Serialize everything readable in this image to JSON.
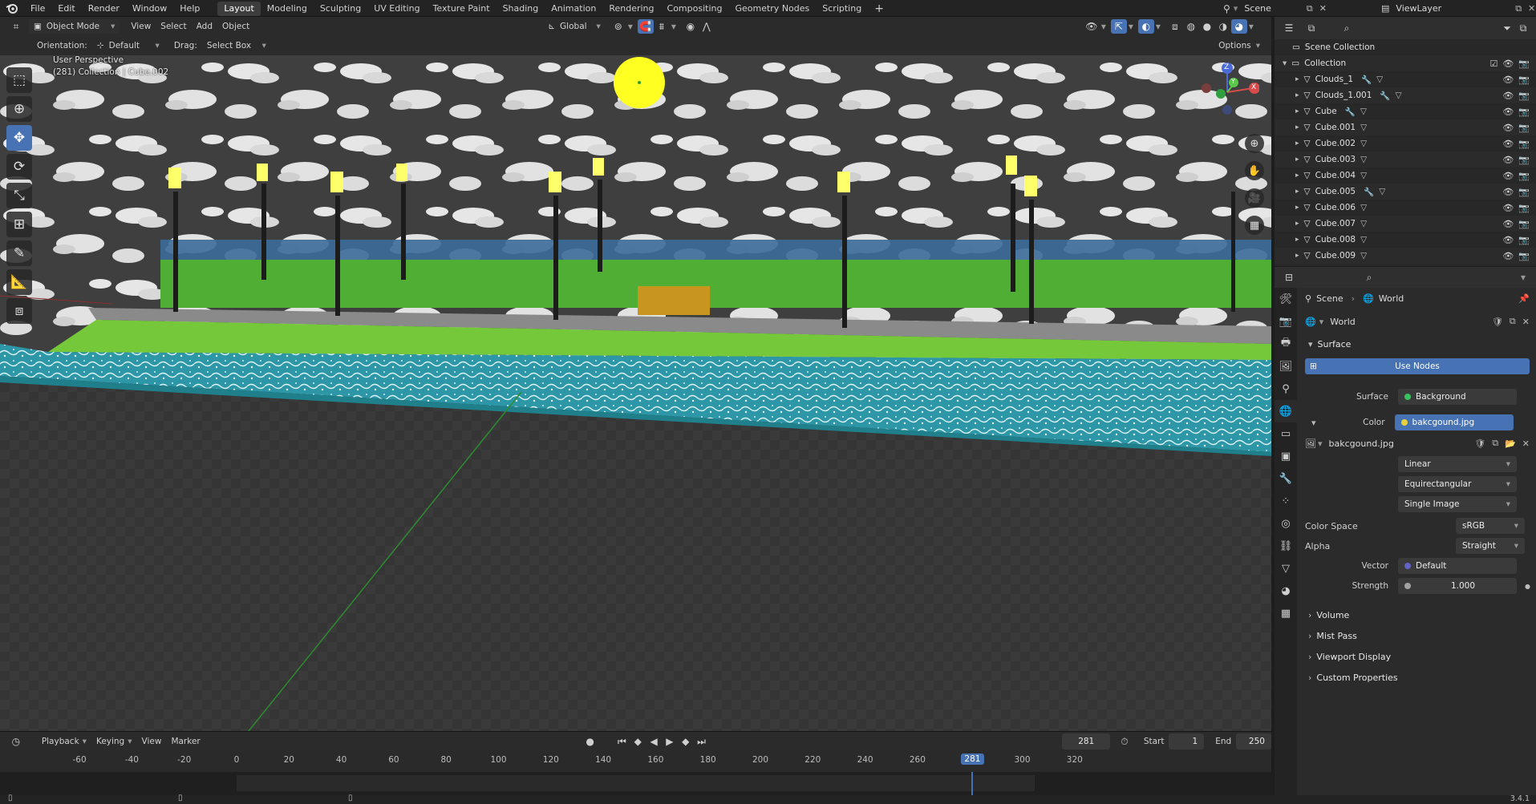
{
  "topbar": {
    "menus": [
      "File",
      "Edit",
      "Render",
      "Window",
      "Help"
    ],
    "workspaces": [
      "Layout",
      "Modeling",
      "Sculpting",
      "UV Editing",
      "Texture Paint",
      "Shading",
      "Animation",
      "Rendering",
      "Compositing",
      "Geometry Nodes",
      "Scripting"
    ],
    "active_workspace": "Layout",
    "add_label": "+",
    "scene_label": "Scene",
    "view_layer_label": "ViewLayer"
  },
  "viewport_header": {
    "mode": "Object Mode",
    "menus": [
      "View",
      "Select",
      "Add",
      "Object"
    ],
    "transform_orientation": "Global",
    "orientation_label": "Orientation:",
    "orientation_value": "Default",
    "drag_label": "Drag:",
    "drag_value": "Select Box",
    "options_label": "Options"
  },
  "viewport": {
    "overlay_line1": "User Perspective",
    "overlay_line2": "(281) Collection | Cube.002",
    "gizmo_axes": {
      "x": "X",
      "y": "Y",
      "z": "Z"
    },
    "colors": {
      "sky": "#c9c9c9",
      "sun": "#ffff22",
      "grass": "#58b33a",
      "water": "#2aa6b0",
      "floor": "#393939"
    }
  },
  "timeline": {
    "menus": [
      "Playback",
      "Keying",
      "View",
      "Marker"
    ],
    "current_frame": "281",
    "start_label": "Start",
    "start_value": "1",
    "end_label": "End",
    "end_value": "250",
    "ticks": [
      "-60",
      "-40",
      "-20",
      "0",
      "20",
      "40",
      "60",
      "80",
      "100",
      "120",
      "140",
      "160",
      "180",
      "200",
      "220",
      "240",
      "260",
      "281",
      "300",
      "320"
    ],
    "playhead_label": "281"
  },
  "statusbar": {
    "version": "3.4.1"
  },
  "outliner": {
    "root": "Scene Collection",
    "collection": "Collection",
    "items": [
      {
        "name": "Clouds_1",
        "modifier": true
      },
      {
        "name": "Clouds_1.001",
        "modifier": true
      },
      {
        "name": "Cube",
        "modifier": true
      },
      {
        "name": "Cube.001",
        "modifier": false
      },
      {
        "name": "Cube.002",
        "modifier": false
      },
      {
        "name": "Cube.003",
        "modifier": false
      },
      {
        "name": "Cube.004",
        "modifier": false
      },
      {
        "name": "Cube.005",
        "modifier": true
      },
      {
        "name": "Cube.006",
        "modifier": false
      },
      {
        "name": "Cube.007",
        "modifier": false
      },
      {
        "name": "Cube.008",
        "modifier": false
      },
      {
        "name": "Cube.009",
        "modifier": false
      }
    ]
  },
  "properties": {
    "breadcrumb_scene": "Scene",
    "breadcrumb_world": "World",
    "world_name": "World",
    "surface_panel": "Surface",
    "use_nodes": "Use Nodes",
    "surface_label": "Surface",
    "surface_value": "Background",
    "color_label": "Color",
    "color_value": "bakcgound.jpg",
    "image_name": "bakcgound.jpg",
    "interpolation": "Linear",
    "projection": "Equirectangular",
    "source": "Single Image",
    "color_space_label": "Color Space",
    "color_space_value": "sRGB",
    "alpha_label": "Alpha",
    "alpha_value": "Straight",
    "vector_label": "Vector",
    "vector_value": "Default",
    "strength_label": "Strength",
    "strength_value": "1.000",
    "collapsed_panels": [
      "Volume",
      "Mist Pass",
      "Viewport Display",
      "Custom Properties"
    ]
  }
}
